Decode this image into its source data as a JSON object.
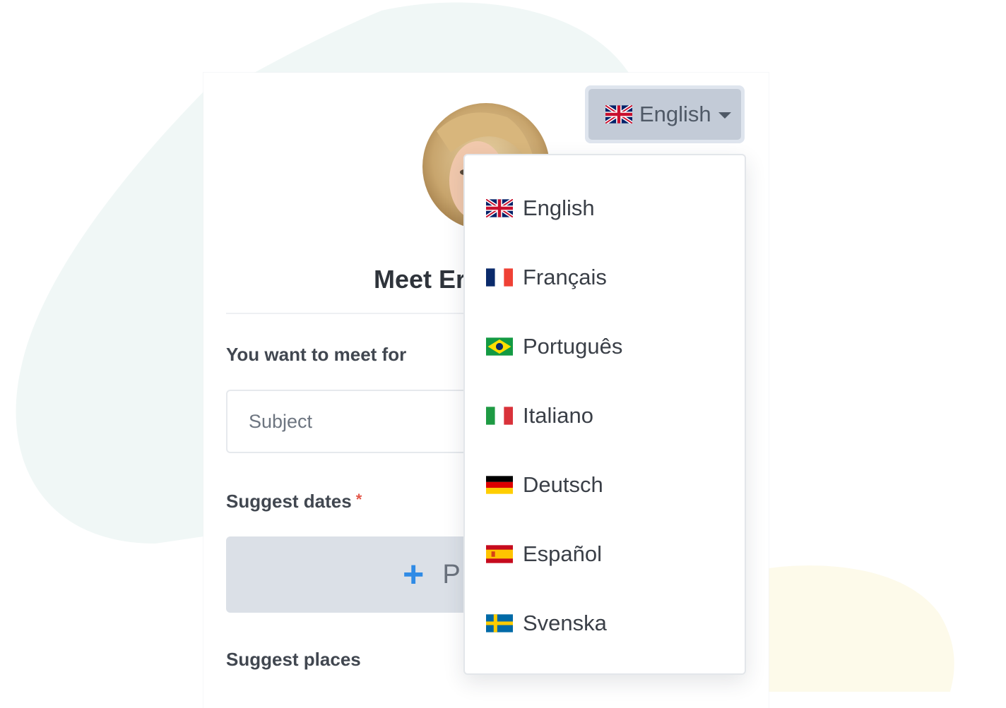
{
  "selector": {
    "current_language": "English",
    "current_flag": "uk-flag-icon"
  },
  "card": {
    "title": "Meet Er",
    "meet_for_label": "You want to meet for",
    "subject_placeholder": "Subject",
    "dates_label": "Suggest dates",
    "required_mark": "*",
    "propose_label": "P",
    "places_label": "Suggest places"
  },
  "dropdown": {
    "items": [
      {
        "label": "English",
        "flag": "uk-flag-icon"
      },
      {
        "label": "Français",
        "flag": "france-flag-icon"
      },
      {
        "label": "Português",
        "flag": "brazil-flag-icon"
      },
      {
        "label": "Italiano",
        "flag": "italy-flag-icon"
      },
      {
        "label": "Deutsch",
        "flag": "germany-flag-icon"
      },
      {
        "label": "Español",
        "flag": "spain-flag-icon"
      },
      {
        "label": "Svenska",
        "flag": "sweden-flag-icon"
      }
    ]
  },
  "colors": {
    "accent_blue": "#2f8be6",
    "required_red": "#e4574a",
    "toggle_bg": "#c3cbd7",
    "button_bg": "#dbe0e7"
  }
}
